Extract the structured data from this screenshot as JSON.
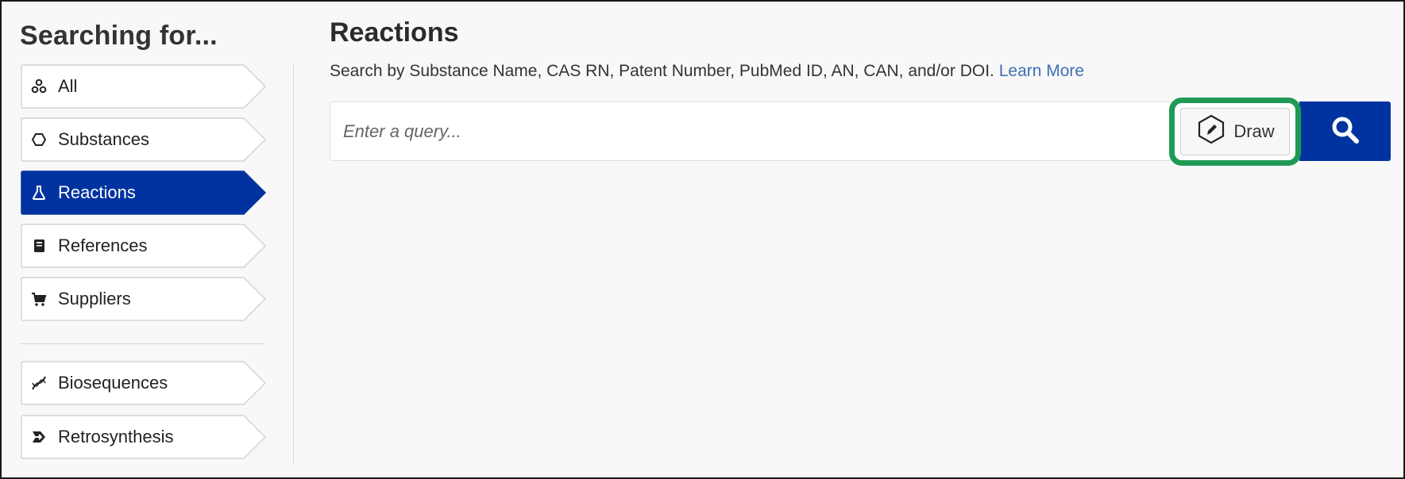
{
  "sidebar": {
    "title": "Searching for...",
    "items": [
      {
        "label": "All",
        "icon": "atoms-icon",
        "active": false
      },
      {
        "label": "Substances",
        "icon": "hexagon-icon",
        "active": false
      },
      {
        "label": "Reactions",
        "icon": "flask-icon",
        "active": true
      },
      {
        "label": "References",
        "icon": "book-icon",
        "active": false
      },
      {
        "label": "Suppliers",
        "icon": "cart-icon",
        "active": false
      },
      {
        "label": "Biosequences",
        "icon": "dna-icon",
        "active": false
      },
      {
        "label": "Retrosynthesis",
        "icon": "retrosynthesis-icon",
        "active": false
      }
    ]
  },
  "main": {
    "title": "Reactions",
    "subtitle": "Search by Substance Name, CAS RN, Patent Number, PubMed ID, AN, CAN, and/or DOI.",
    "learn_more": "Learn More",
    "search": {
      "placeholder": "Enter a query...",
      "value": "",
      "draw_label": "Draw"
    }
  },
  "colors": {
    "active_nav": "#0033a0",
    "search_button": "#0033a0",
    "highlight": "#1f9a55",
    "link": "#3f6fb5"
  }
}
